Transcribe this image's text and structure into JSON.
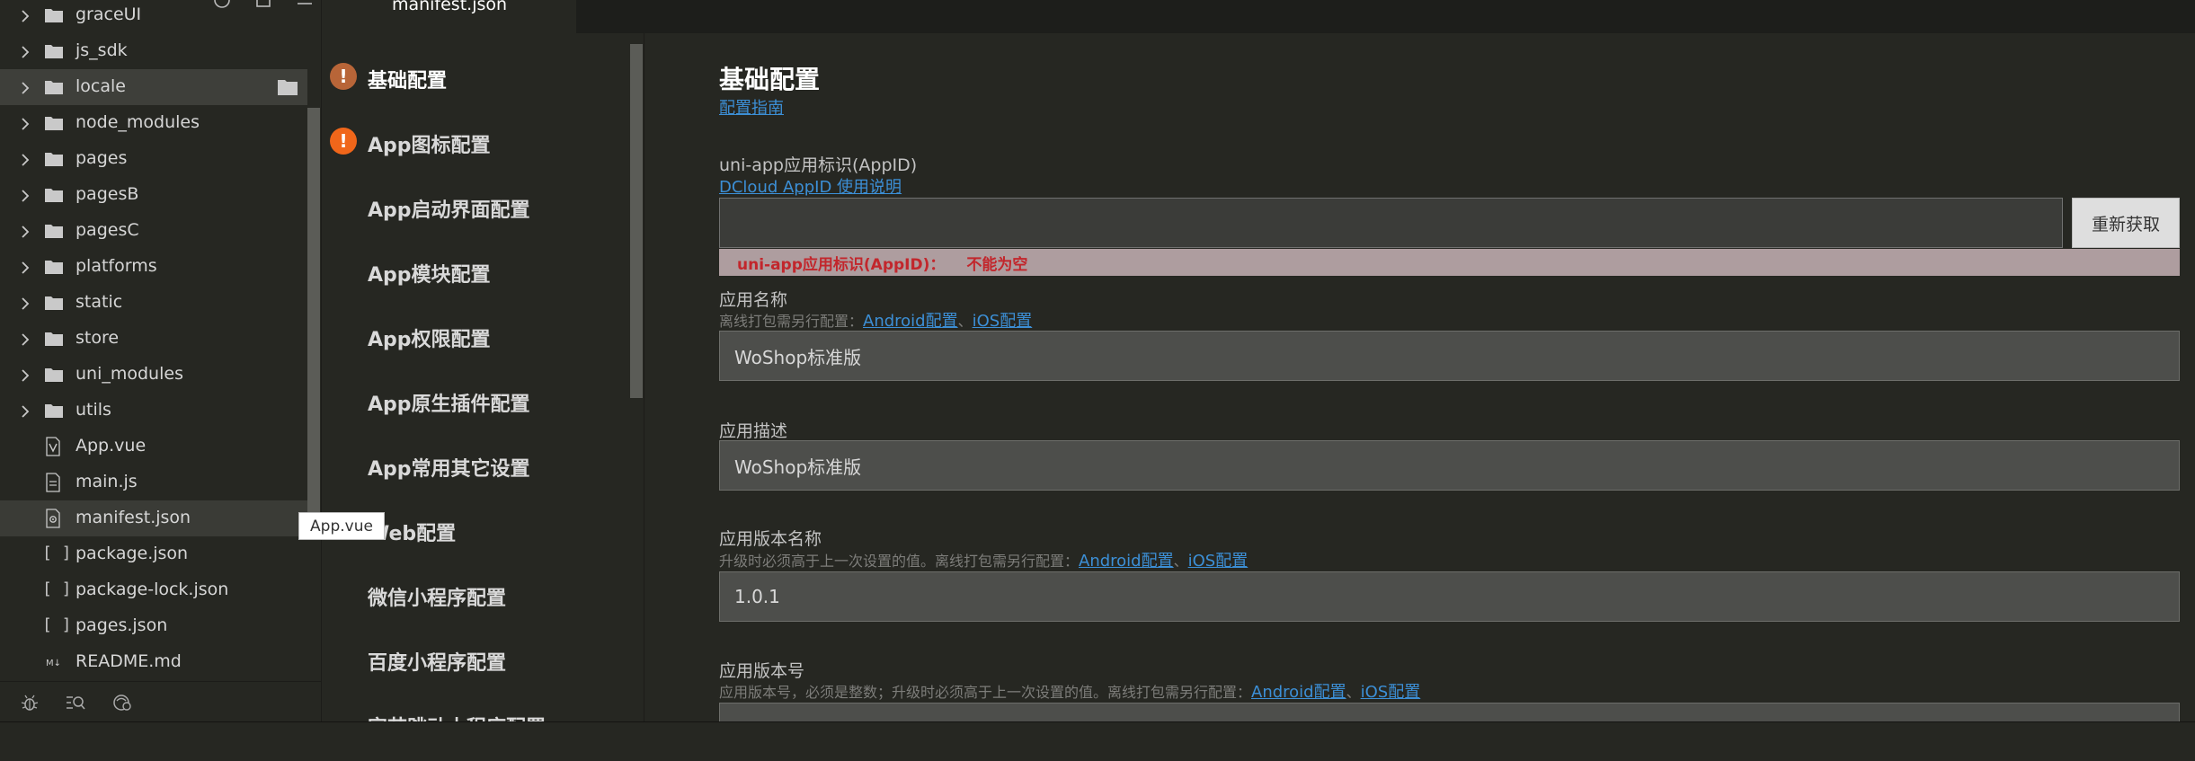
{
  "explorer": {
    "items": [
      {
        "label": "graceUI",
        "type": "folder"
      },
      {
        "label": "js_sdk",
        "type": "folder"
      },
      {
        "label": "locale",
        "type": "folder"
      },
      {
        "label": "node_modules",
        "type": "folder"
      },
      {
        "label": "pages",
        "type": "folder"
      },
      {
        "label": "pagesB",
        "type": "folder"
      },
      {
        "label": "pagesC",
        "type": "folder"
      },
      {
        "label": "platforms",
        "type": "folder"
      },
      {
        "label": "static",
        "type": "folder"
      },
      {
        "label": "store",
        "type": "folder"
      },
      {
        "label": "uni_modules",
        "type": "folder"
      },
      {
        "label": "utils",
        "type": "folder"
      },
      {
        "label": "App.vue",
        "type": "vue-file"
      },
      {
        "label": "main.js",
        "type": "js-file"
      },
      {
        "label": "manifest.json",
        "type": "json-gear-file"
      },
      {
        "label": "package.json",
        "type": "json-file"
      },
      {
        "label": "package-lock.json",
        "type": "json-file"
      },
      {
        "label": "pages.json",
        "type": "json-file"
      },
      {
        "label": "README.md",
        "type": "md-file"
      }
    ],
    "hover_item": "locale",
    "selected_item": "manifest.json",
    "tooltip": "App.vue"
  },
  "tabs": {
    "active": "manifest.json"
  },
  "config_nav": {
    "items": [
      {
        "label": "基础配置",
        "warning": "orange-brown"
      },
      {
        "label": "App图标配置",
        "warning": "orange"
      },
      {
        "label": "App启动界面配置"
      },
      {
        "label": "App模块配置"
      },
      {
        "label": "App权限配置"
      },
      {
        "label": "App原生插件配置"
      },
      {
        "label": "App常用其它设置"
      },
      {
        "label": "Web配置"
      },
      {
        "label": "微信小程序配置"
      },
      {
        "label": "百度小程序配置"
      },
      {
        "label": "字节跳动小程序配置"
      }
    ],
    "warning_symbol": "!"
  },
  "form": {
    "title": "基础配置",
    "guide_link": "配置指南",
    "appid": {
      "label": "uni-app应用标识(AppID)",
      "help_link": "DCloud AppID 使用说明",
      "value": "",
      "refetch_label": "重新获取",
      "error_label": "uni-app应用标识(AppID)：",
      "error_msg": "不能为空"
    },
    "app_name": {
      "label": "应用名称",
      "hint": "离线打包需另行配置：",
      "value": "WoShop标准版"
    },
    "app_desc": {
      "label": "应用描述",
      "value": "WoShop标准版"
    },
    "version_name": {
      "label": "应用版本名称",
      "hint": "升级时必须高于上一次设置的值。离线打包需另行配置：",
      "value": "1.0.1"
    },
    "version_code": {
      "label": "应用版本号",
      "hint": "应用版本号，必须是整数；升级时必须高于上一次设置的值。离线打包需另行配置：",
      "value": ""
    },
    "android_link": "Android配置",
    "sep": "、",
    "ios_link": "iOS配置"
  },
  "colors": {
    "bg": "#262722",
    "link": "#3c8fd6",
    "error": "#c2262c",
    "warn_orange": "#f0661a",
    "warn_brown": "#b86538"
  }
}
